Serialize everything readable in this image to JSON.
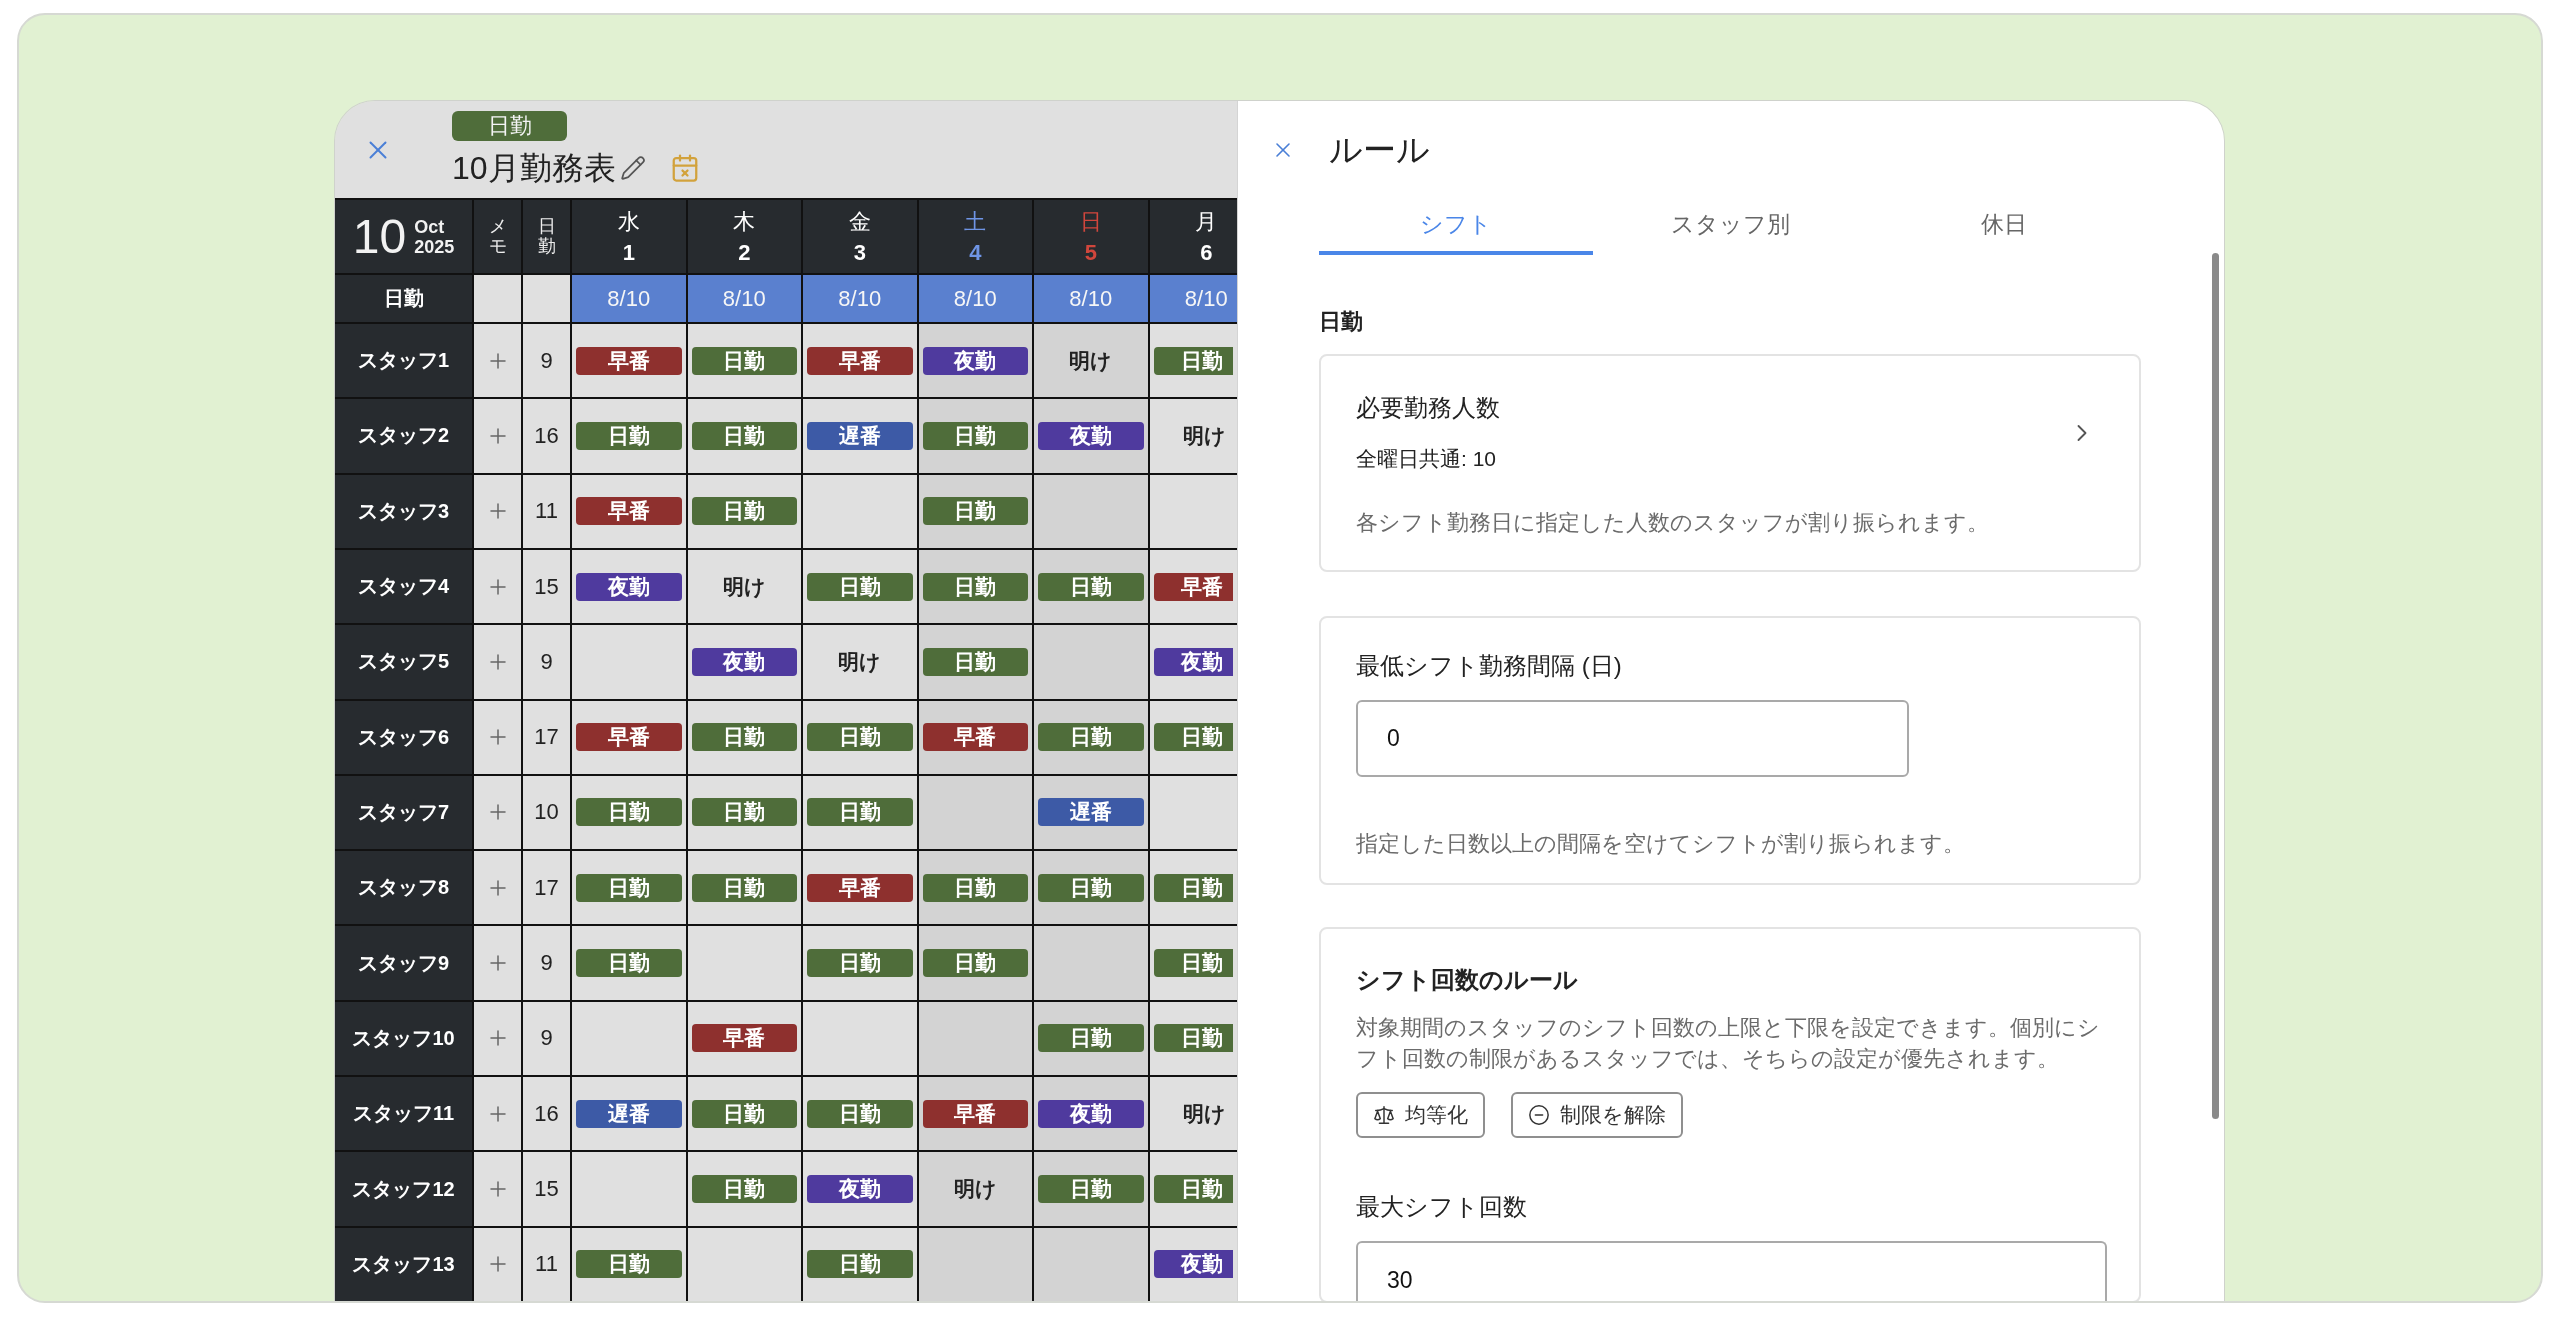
{
  "schedule": {
    "badge": "日勤",
    "title": "10月勤務表",
    "corner": {
      "day": "10",
      "month": "Oct",
      "year": "2025"
    },
    "side_columns": [
      "メモ",
      "日勤"
    ],
    "days": [
      {
        "weekday": "水",
        "date": "1",
        "kind": "weekday"
      },
      {
        "weekday": "木",
        "date": "2",
        "kind": "weekday"
      },
      {
        "weekday": "金",
        "date": "3",
        "kind": "weekday"
      },
      {
        "weekday": "土",
        "date": "4",
        "kind": "saturday"
      },
      {
        "weekday": "日",
        "date": "5",
        "kind": "sunday"
      },
      {
        "weekday": "月",
        "date": "6",
        "kind": "weekday"
      }
    ],
    "summary": {
      "label": "日勤",
      "values": [
        "8/10",
        "8/10",
        "8/10",
        "8/10",
        "8/10",
        "8/10"
      ]
    },
    "rows": [
      {
        "name": "スタッフ1",
        "count": "9",
        "cells": [
          {
            "kind": "tag",
            "label": "早番",
            "color": "#8e302e"
          },
          {
            "kind": "tag",
            "label": "日勤",
            "color": "#4f6d3a"
          },
          {
            "kind": "tag",
            "label": "早番",
            "color": "#8e302e"
          },
          {
            "kind": "tag",
            "label": "夜勤",
            "color": "#4f3a9e"
          },
          {
            "kind": "text",
            "label": "明け"
          },
          {
            "kind": "tag",
            "label": "日勤",
            "color": "#4f6d3a"
          }
        ]
      },
      {
        "name": "スタッフ2",
        "count": "16",
        "cells": [
          {
            "kind": "tag",
            "label": "日勤",
            "color": "#4f6d3a"
          },
          {
            "kind": "tag",
            "label": "日勤",
            "color": "#4f6d3a"
          },
          {
            "kind": "tag",
            "label": "遅番",
            "color": "#3d5aa6"
          },
          {
            "kind": "tag",
            "label": "日勤",
            "color": "#4f6d3a"
          },
          {
            "kind": "tag",
            "label": "夜勤",
            "color": "#4f3a9e"
          },
          {
            "kind": "text",
            "label": "明け"
          }
        ]
      },
      {
        "name": "スタッフ3",
        "count": "11",
        "cells": [
          {
            "kind": "tag",
            "label": "早番",
            "color": "#8e302e"
          },
          {
            "kind": "tag",
            "label": "日勤",
            "color": "#4f6d3a"
          },
          null,
          {
            "kind": "tag",
            "label": "日勤",
            "color": "#4f6d3a"
          },
          null,
          null
        ]
      },
      {
        "name": "スタッフ4",
        "count": "15",
        "cells": [
          {
            "kind": "tag",
            "label": "夜勤",
            "color": "#4f3a9e"
          },
          {
            "kind": "text",
            "label": "明け"
          },
          {
            "kind": "tag",
            "label": "日勤",
            "color": "#4f6d3a"
          },
          {
            "kind": "tag",
            "label": "日勤",
            "color": "#4f6d3a"
          },
          {
            "kind": "tag",
            "label": "日勤",
            "color": "#4f6d3a"
          },
          {
            "kind": "tag",
            "label": "早番",
            "color": "#8e302e"
          }
        ]
      },
      {
        "name": "スタッフ5",
        "count": "9",
        "cells": [
          null,
          {
            "kind": "tag",
            "label": "夜勤",
            "color": "#4f3a9e"
          },
          {
            "kind": "text",
            "label": "明け"
          },
          {
            "kind": "tag",
            "label": "日勤",
            "color": "#4f6d3a"
          },
          null,
          {
            "kind": "tag",
            "label": "夜勤",
            "color": "#4f3a9e"
          }
        ]
      },
      {
        "name": "スタッフ6",
        "count": "17",
        "cells": [
          {
            "kind": "tag",
            "label": "早番",
            "color": "#8e302e"
          },
          {
            "kind": "tag",
            "label": "日勤",
            "color": "#4f6d3a"
          },
          {
            "kind": "tag",
            "label": "日勤",
            "color": "#4f6d3a"
          },
          {
            "kind": "tag",
            "label": "早番",
            "color": "#8e302e"
          },
          {
            "kind": "tag",
            "label": "日勤",
            "color": "#4f6d3a"
          },
          {
            "kind": "tag",
            "label": "日勤",
            "color": "#4f6d3a"
          }
        ]
      },
      {
        "name": "スタッフ7",
        "count": "10",
        "cells": [
          {
            "kind": "tag",
            "label": "日勤",
            "color": "#4f6d3a"
          },
          {
            "kind": "tag",
            "label": "日勤",
            "color": "#4f6d3a"
          },
          {
            "kind": "tag",
            "label": "日勤",
            "color": "#4f6d3a"
          },
          null,
          {
            "kind": "tag",
            "label": "遅番",
            "color": "#3d5aa6"
          },
          null
        ]
      },
      {
        "name": "スタッフ8",
        "count": "17",
        "cells": [
          {
            "kind": "tag",
            "label": "日勤",
            "color": "#4f6d3a"
          },
          {
            "kind": "tag",
            "label": "日勤",
            "color": "#4f6d3a"
          },
          {
            "kind": "tag",
            "label": "早番",
            "color": "#8e302e"
          },
          {
            "kind": "tag",
            "label": "日勤",
            "color": "#4f6d3a"
          },
          {
            "kind": "tag",
            "label": "日勤",
            "color": "#4f6d3a"
          },
          {
            "kind": "tag",
            "label": "日勤",
            "color": "#4f6d3a"
          }
        ]
      },
      {
        "name": "スタッフ9",
        "count": "9",
        "cells": [
          {
            "kind": "tag",
            "label": "日勤",
            "color": "#4f6d3a"
          },
          null,
          {
            "kind": "tag",
            "label": "日勤",
            "color": "#4f6d3a"
          },
          {
            "kind": "tag",
            "label": "日勤",
            "color": "#4f6d3a"
          },
          null,
          {
            "kind": "tag",
            "label": "日勤",
            "color": "#4f6d3a"
          }
        ]
      },
      {
        "name": "スタッフ10",
        "count": "9",
        "cells": [
          null,
          {
            "kind": "tag",
            "label": "早番",
            "color": "#8e302e"
          },
          null,
          null,
          {
            "kind": "tag",
            "label": "日勤",
            "color": "#4f6d3a"
          },
          {
            "kind": "tag",
            "label": "日勤",
            "color": "#4f6d3a"
          }
        ]
      },
      {
        "name": "スタッフ11",
        "count": "16",
        "cells": [
          {
            "kind": "tag",
            "label": "遅番",
            "color": "#3d5aa6"
          },
          {
            "kind": "tag",
            "label": "日勤",
            "color": "#4f6d3a"
          },
          {
            "kind": "tag",
            "label": "日勤",
            "color": "#4f6d3a"
          },
          {
            "kind": "tag",
            "label": "早番",
            "color": "#8e302e"
          },
          {
            "kind": "tag",
            "label": "夜勤",
            "color": "#4f3a9e"
          },
          {
            "kind": "text",
            "label": "明け"
          }
        ]
      },
      {
        "name": "スタッフ12",
        "count": "15",
        "cells": [
          null,
          {
            "kind": "tag",
            "label": "日勤",
            "color": "#4f6d3a"
          },
          {
            "kind": "tag",
            "label": "夜勤",
            "color": "#4f3a9e"
          },
          {
            "kind": "text",
            "label": "明け"
          },
          {
            "kind": "tag",
            "label": "日勤",
            "color": "#4f6d3a"
          },
          {
            "kind": "tag",
            "label": "日勤",
            "color": "#4f6d3a"
          }
        ]
      },
      {
        "name": "スタッフ13",
        "count": "11",
        "cells": [
          {
            "kind": "tag",
            "label": "日勤",
            "color": "#4f6d3a"
          },
          null,
          {
            "kind": "tag",
            "label": "日勤",
            "color": "#4f6d3a"
          },
          null,
          null,
          {
            "kind": "tag",
            "label": "夜勤",
            "color": "#4f3a9e"
          }
        ]
      }
    ]
  },
  "rules": {
    "title": "ルール",
    "tabs": [
      {
        "label": "シフト",
        "selected": true
      },
      {
        "label": "スタッフ別",
        "selected": false
      },
      {
        "label": "休日",
        "selected": false
      }
    ],
    "section": "日勤",
    "cards": [
      {
        "kind": "link",
        "title": "必要勤務人数",
        "value": "全曜日共通: 10",
        "description": "各シフト勤務日に指定した人数のスタッフが割り振られます。"
      },
      {
        "kind": "input",
        "label": "最低シフト勤務間隔 (日)",
        "value": "0",
        "description": "指定した日数以上の間隔を空けてシフトが割り振られます。"
      },
      {
        "kind": "limits",
        "title": "シフト回数のルール",
        "description": "対象期間のスタッフのシフト回数の上限と下限を設定できます。個別にシフト回数の制限があるスタッフでは、そちらの設定が優先されます。",
        "buttons": [
          {
            "kind": "balance",
            "label": "均等化"
          },
          {
            "kind": "clear",
            "label": "制限を解除"
          }
        ],
        "field": {
          "label": "最大シフト回数",
          "value": "30"
        }
      }
    ]
  }
}
